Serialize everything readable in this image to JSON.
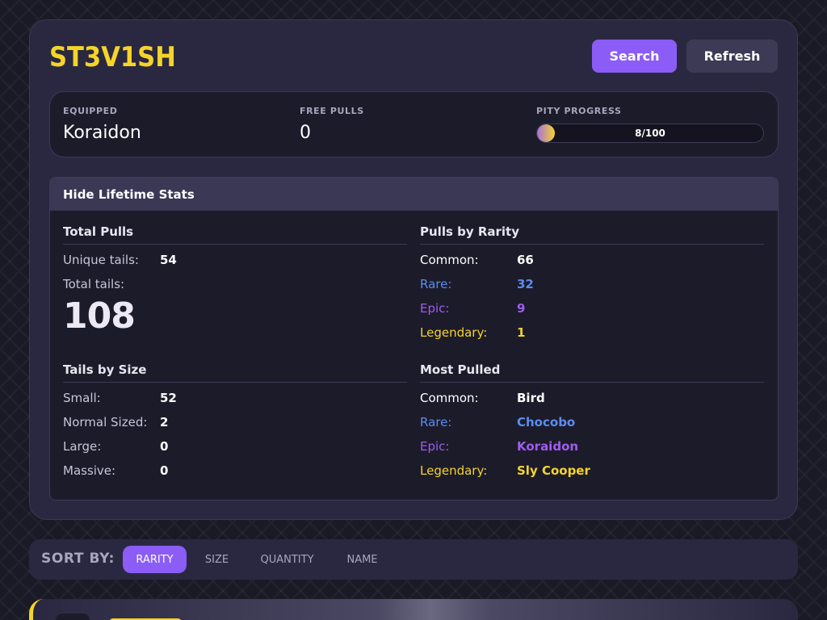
{
  "profile": {
    "username": "ST3V1SH",
    "buttons": {
      "search": "Search",
      "refresh": "Refresh"
    }
  },
  "status": {
    "equipped_label": "EQUIPPED",
    "equipped_value": "Koraidon",
    "free_pulls_label": "FREE PULLS",
    "free_pulls_value": "0",
    "pity_label": "PITY PROGRESS",
    "pity_text": "8/100",
    "pity_fraction": 0.08
  },
  "stats": {
    "toggle_label": "Hide Lifetime Stats",
    "total_pulls": {
      "title": "Total Pulls",
      "unique_label": "Unique tails:",
      "unique_value": "54",
      "total_label": "Total tails:",
      "total_value": "108"
    },
    "by_rarity": {
      "title": "Pulls by Rarity",
      "rows": [
        {
          "label": "Common:",
          "value": "66",
          "color": "#ffffff"
        },
        {
          "label": "Rare:",
          "value": "32",
          "color": "#5b8def"
        },
        {
          "label": "Epic:",
          "value": "9",
          "color": "#a05cf0"
        },
        {
          "label": "Legendary:",
          "value": "1",
          "color": "#f5d42a"
        }
      ]
    },
    "by_size": {
      "title": "Tails by Size",
      "rows": [
        {
          "label": "Small:",
          "value": "52"
        },
        {
          "label": "Normal Sized:",
          "value": "2"
        },
        {
          "label": "Large:",
          "value": "0"
        },
        {
          "label": "Massive:",
          "value": "0"
        }
      ]
    },
    "most_pulled": {
      "title": "Most Pulled",
      "rows": [
        {
          "label": "Common:",
          "value": "Bird",
          "color": "#ffffff"
        },
        {
          "label": "Rare:",
          "value": "Chocobo",
          "color": "#5b8def"
        },
        {
          "label": "Epic:",
          "value": "Koraidon",
          "color": "#a05cf0"
        },
        {
          "label": "Legendary:",
          "value": "Sly Cooper",
          "color": "#f5d42a"
        }
      ]
    }
  },
  "sort": {
    "label": "SORT BY:",
    "options": [
      "RARITY",
      "SIZE",
      "QUANTITY",
      "NAME"
    ],
    "active": "RARITY"
  },
  "colors": {
    "accent": "#8b5cf6",
    "brand_yellow": "#f5d42a",
    "rare": "#5b8def",
    "epic": "#a05cf0",
    "legendary": "#f5d42a"
  }
}
